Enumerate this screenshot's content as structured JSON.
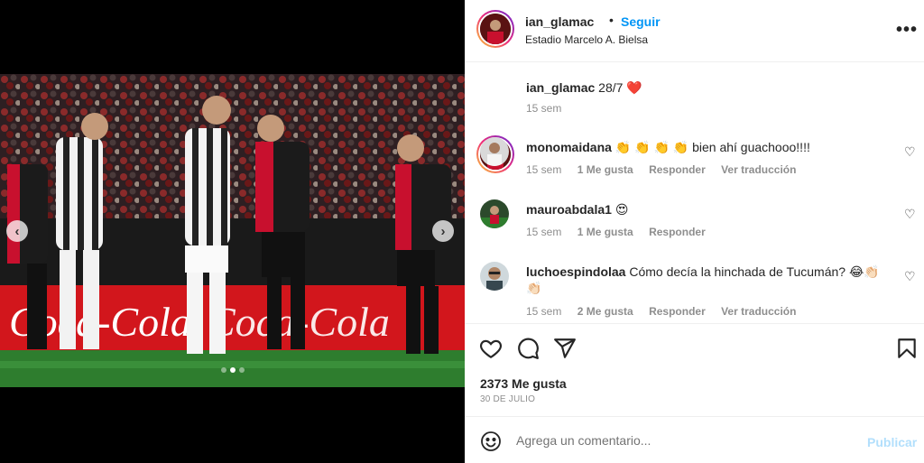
{
  "header": {
    "username": "ian_glamac",
    "separator": "•",
    "follow_label": "Seguir",
    "location": "Estadio Marcelo A. Bielsa",
    "more_icon": "more-horizontal-icon"
  },
  "media": {
    "prev_icon": "chevron-left-icon",
    "next_icon": "chevron-right-icon",
    "carousel": {
      "total": 3,
      "active_index": 1
    },
    "photo_description_icon": "soccer-photo"
  },
  "caption": {
    "username": "ian_glamac",
    "text": "28/7",
    "emoji": "❤️",
    "time": "15 sem"
  },
  "comments": [
    {
      "username": "monomaidana",
      "text": "👏 👏 👏 👏 bien ahí guachooo!!!!",
      "time": "15 sem",
      "likes": "1 Me gusta",
      "reply": "Responder",
      "translate": "Ver traducción"
    },
    {
      "username": "mauroabdala1",
      "text": "😍",
      "time": "15 sem",
      "likes": "1 Me gusta",
      "reply": "Responder"
    },
    {
      "username": "luchoespindolaa",
      "text": "Cómo decía la hinchada de Tucumán? 😂👏🏻 👏🏻",
      "time": "15 sem",
      "likes": "2 Me gusta",
      "reply": "Responder",
      "translate": "Ver traducción"
    }
  ],
  "actions": {
    "like_icon": "heart-icon",
    "comment_icon": "comment-icon",
    "share_icon": "send-icon",
    "save_icon": "bookmark-icon",
    "likes": "2373 Me gusta",
    "date": "30 DE JULIO"
  },
  "add_comment": {
    "emoji_icon": "smiley-icon",
    "placeholder": "Agrega un comentario...",
    "post_label": "Publicar"
  },
  "colors": {
    "link_blue": "#0095f6",
    "post_disabled": "#b2dffc",
    "heart_red": "#ed4956",
    "muted": "#8e8e8e"
  }
}
